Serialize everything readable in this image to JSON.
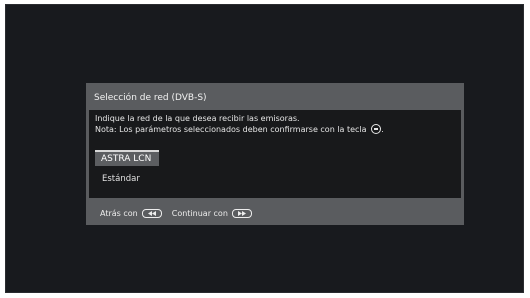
{
  "dialog": {
    "title": "Selección de red (DVB-S)",
    "instruction_line1": "Indique la red de la que desea recibir las emisoras.",
    "instruction_line2": "Nota: Los parámetros seleccionados deben confirmarse con la tecla",
    "instruction_key_icon": "ok-key-icon",
    "instruction_end": "."
  },
  "options": [
    {
      "label": "ASTRA LCN",
      "selected": true
    },
    {
      "label": "Estándar",
      "selected": false
    }
  ],
  "footer": {
    "back_label": "Atrás con",
    "back_icon": "rewind-key-icon",
    "continue_label": "Continuar con",
    "continue_icon": "fast-forward-key-icon"
  }
}
